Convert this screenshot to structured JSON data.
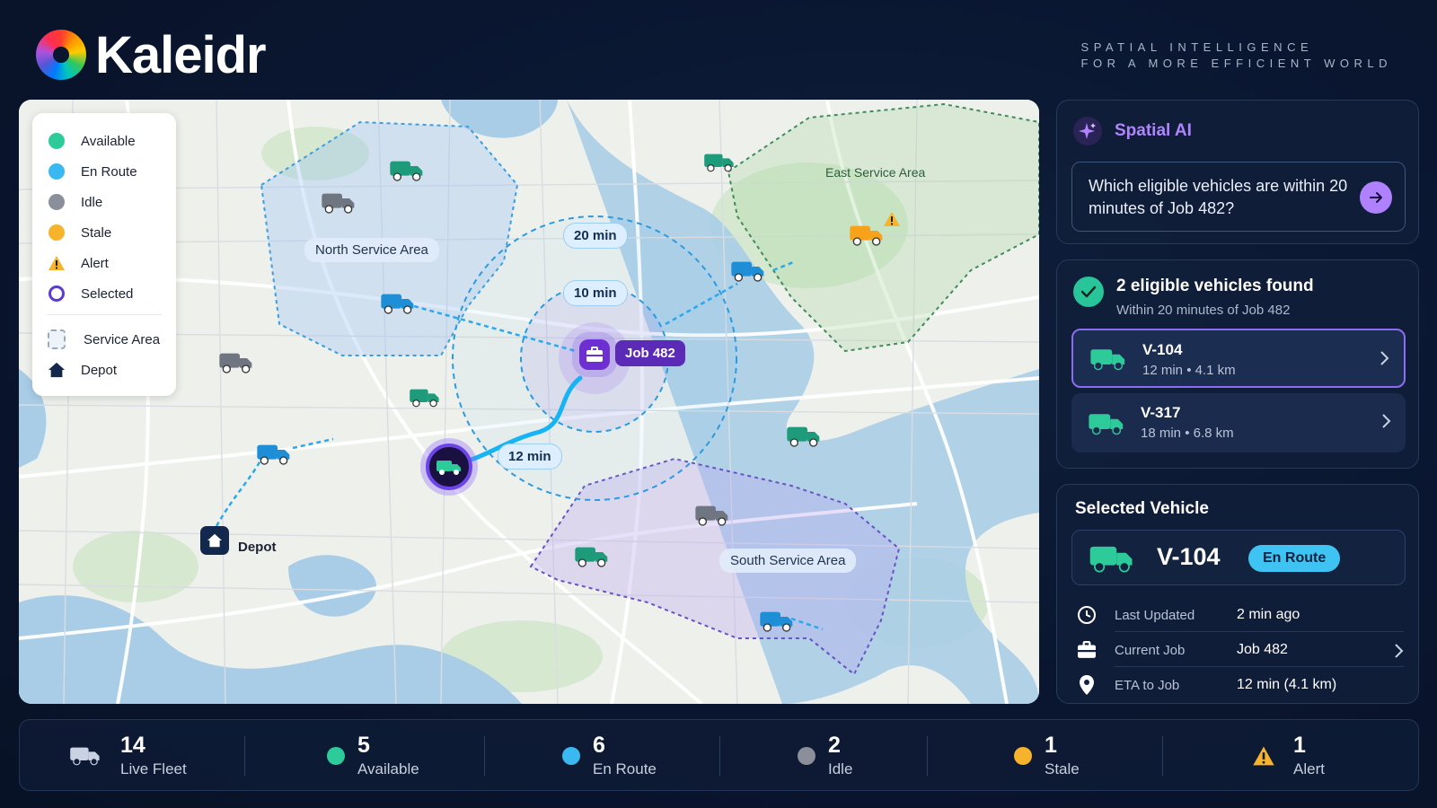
{
  "brand": {
    "name": "Kaleidr",
    "tagline_line1": "SPATIAL INTELLIGENCE",
    "tagline_line2": "FOR A MORE EFFICIENT WORLD"
  },
  "legend": {
    "items": [
      {
        "label": "Available",
        "color": "#2ecb9a"
      },
      {
        "label": "En Route",
        "color": "#3ab8f0"
      },
      {
        "label": "Idle",
        "color": "#8a8f9a"
      },
      {
        "label": "Stale",
        "color": "#f6b32b"
      },
      {
        "label": "Alert",
        "icon": "warning-icon"
      },
      {
        "label": "Selected",
        "icon": "selected-ring-icon"
      },
      {
        "label": "Service Area",
        "icon": "dashed-square-icon"
      },
      {
        "label": "Depot",
        "icon": "home-icon"
      }
    ]
  },
  "map": {
    "areas": {
      "north": "North Service Area",
      "east": "East Service Area",
      "south": "South Service Area"
    },
    "rings": {
      "outer": "20 min",
      "inner": "10 min"
    },
    "route_label": "12 min",
    "job_label": "Job 482",
    "depot_label": "Depot"
  },
  "ai": {
    "title": "Spatial AI",
    "query": "Which eligible vehicles are within 20 minutes of Job 482?"
  },
  "results": {
    "title": "2 eligible vehicles found",
    "subtitle": "Within 20 minutes of Job 482",
    "vehicles": [
      {
        "id": "V-104",
        "meta": "12 min  •  4.1 km"
      },
      {
        "id": "V-317",
        "meta": "18 min  •  6.8 km"
      }
    ]
  },
  "selected": {
    "title": "Selected Vehicle",
    "id": "V-104",
    "status": "En Route",
    "details": [
      {
        "label": "Last Updated",
        "value": "2 min ago"
      },
      {
        "label": "Current Job",
        "value": "Job 482"
      },
      {
        "label": "ETA to Job",
        "value": "12 min (4.1 km)"
      }
    ]
  },
  "stats": [
    {
      "value": "14",
      "label": "Live Fleet"
    },
    {
      "value": "5",
      "label": "Available",
      "color": "#2ecb9a"
    },
    {
      "value": "6",
      "label": "En Route",
      "color": "#3ab8f0"
    },
    {
      "value": "2",
      "label": "Idle",
      "color": "#8a8f9a"
    },
    {
      "value": "1",
      "label": "Stale",
      "color": "#f6b32b"
    },
    {
      "value": "1",
      "label": "Alert"
    }
  ]
}
